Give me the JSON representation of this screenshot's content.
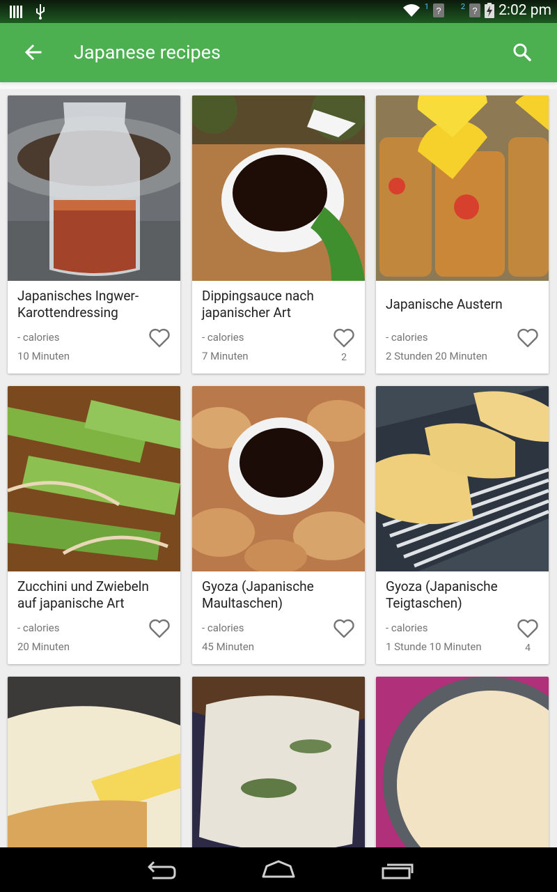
{
  "status": {
    "time": "2:02 pm",
    "sim1": "1",
    "sim2": "2"
  },
  "appbar": {
    "title": "Japanese recipes"
  },
  "recipes": [
    {
      "name": "Japanisches Ingwer-Karottendressing",
      "calories": "- calories",
      "time": "10 Minuten",
      "likes": ""
    },
    {
      "name": "Dippingsauce nach japanischer Art",
      "calories": "- calories",
      "time": "7 Minuten",
      "likes": "2"
    },
    {
      "name": "Japanische Austern",
      "calories": "- calories",
      "time": "2 Stunden 20 Minuten",
      "likes": ""
    },
    {
      "name": "Zucchini und Zwiebeln auf japanische Art",
      "calories": "- calories",
      "time": "20 Minuten",
      "likes": ""
    },
    {
      "name": "Gyoza (Japanische Maultaschen)",
      "calories": "- calories",
      "time": "45 Minuten",
      "likes": ""
    },
    {
      "name": "Gyoza (Japanische Teigtaschen)",
      "calories": "- calories",
      "time": "1 Stunde 10 Minuten",
      "likes": "4"
    }
  ],
  "colors": {
    "primary": "#4caf50",
    "status_bar": "#1e5a22"
  },
  "icons": {
    "back": "arrow-back-icon",
    "search": "search-icon",
    "favorite": "heart-outline-icon"
  }
}
